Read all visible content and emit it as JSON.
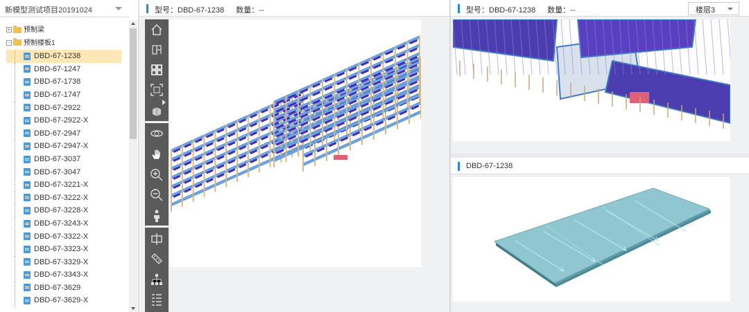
{
  "project": {
    "name": "新模型测试项目20191024"
  },
  "tree": {
    "groups": [
      {
        "toggle": "+",
        "label": "预制梁"
      },
      {
        "toggle": "-",
        "label": "预制楼板1"
      }
    ],
    "items": [
      "DBD-67-1238",
      "DBD-67-1247",
      "DBD-67-1738",
      "DBD-67-1747",
      "DBD-67-2922",
      "DBD-67-2922-X",
      "DBD-67-2947",
      "DBD-67-2947-X",
      "DBD-67-3037",
      "DBD-67-3047",
      "DBD-67-3221-X",
      "DBD-67-3222-X",
      "DBD-67-3228-X",
      "DBD-67-3243-X",
      "DBD-67-3322-X",
      "DBD-67-3323-X",
      "DBD-67-3329-X",
      "DBD-67-3343-X",
      "DBD-67-3629",
      "DBD-67-3629-X"
    ],
    "selected_index": 0
  },
  "viewer_header": {
    "model_label": "型号：DBD-67-1238",
    "count_label": "数量：--"
  },
  "floor_header": {
    "model_label": "型号：DBD-67-1238",
    "count_label": "数量：--",
    "floor_select": "楼层3"
  },
  "detail_header": {
    "title": "DBD-67-1238"
  },
  "toolbar_icons": [
    "home-icon",
    "view-front-icon",
    "view-grid-icon",
    "fit-view-icon",
    "cube-views-icon",
    "orbit-icon",
    "pan-hand-icon",
    "zoom-in-icon",
    "zoom-out-icon",
    "walk-person-icon",
    "section-icon",
    "measure-ruler-icon",
    "model-tree-icon",
    "properties-list-icon"
  ],
  "colors": {
    "accent": "#2a87d5",
    "selected": "#fde7b6",
    "toolbar": "#5a5a5a",
    "slab": "#8fc6cf"
  }
}
